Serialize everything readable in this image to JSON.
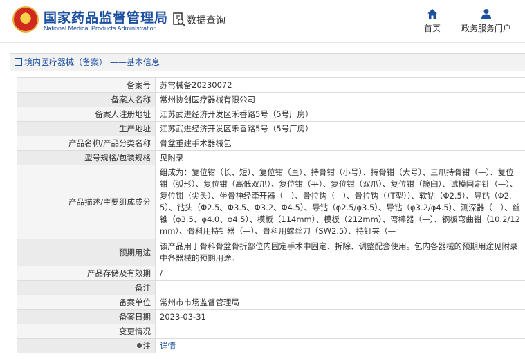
{
  "header": {
    "site_title_cn": "国家药品监督管理局",
    "site_title_en": "National Medical Products Administration",
    "query_label": "数据查询",
    "nav": {
      "home": "首页",
      "portal": "政务服务门户"
    }
  },
  "breadcrumb": "境内医疗器械（备案） ——基本信息",
  "record": {
    "rows": [
      {
        "key": "备案号",
        "value": "苏常械备20230072"
      },
      {
        "key": "备案人名称",
        "value": "常州协创医疗器械有限公司"
      },
      {
        "key": "备案人注册地址",
        "value": "江苏武进经济开发区禾香路5号（5号厂房）"
      },
      {
        "key": "生产地址",
        "value": "江苏武进经济开发区禾香路5号（5号厂房）"
      },
      {
        "key": "产品名称/产品分类名称",
        "value": "骨盆重建手术器械包"
      },
      {
        "key": "型号规格/包装规格",
        "value": "见附录"
      },
      {
        "key": "产品描述/主要组成成分",
        "value": "组成为：复位钳（长、短）、复位钳（直）、持骨钳（小号）、持骨钳（大号）、三爪持骨钳（—）、复位钳（弧形）、复位钳（高低双爪）、复位钳（平）、复位钳（双爪）、复位钳（髋臼）、试模固定针（—）、复位钳（尖头）、坐骨神经牵开器（—）、骨拉钩（—）、骨拉钩（（T型））、软钻（Φ2.5）、导钻（Φ2.5）、钻头（Φ2.5、Φ3.5、Φ3.2、Φ4.5）、导钻（φ2.5/φ3.5）、导钻（φ3.2/φ4.5）、测深器（—）、丝锥（φ3.5、φ4.0、φ4.5）、模板（114mm）、模板（212mm）、弯棒器（—）、钢板弯曲钳（10.2/12mm）、骨科用持钉器（—）、骨科用螺丝刀（SW2.5）、持钉夹（—"
      },
      {
        "key": "预期用途",
        "value": "该产品用于骨科骨盆骨折部位内固定手术中固定、拆除、调整配套使用。包内各器械的预期用途见附录中各器械的预期用途。"
      },
      {
        "key": "产品存储及有效期",
        "value": "/"
      },
      {
        "key": "备注",
        "value": ""
      },
      {
        "key": "备案单位",
        "value": "常州市市场监督管理局"
      },
      {
        "key": "备案日期",
        "value": "2023-03-31"
      },
      {
        "key": "变更情况",
        "value": ""
      }
    ],
    "note_label": "注",
    "note_link": "详情"
  },
  "colors": {
    "brand_blue": "#1b4fa0",
    "emblem_red": "#d1281f",
    "emblem_gold": "#f6d24a"
  },
  "icons": {
    "emblem": "national-emblem-icon",
    "query": "document-search-icon",
    "home": "home-icon",
    "portal": "user-icon",
    "breadcrumb": "document-icon",
    "note": "pin-icon"
  }
}
